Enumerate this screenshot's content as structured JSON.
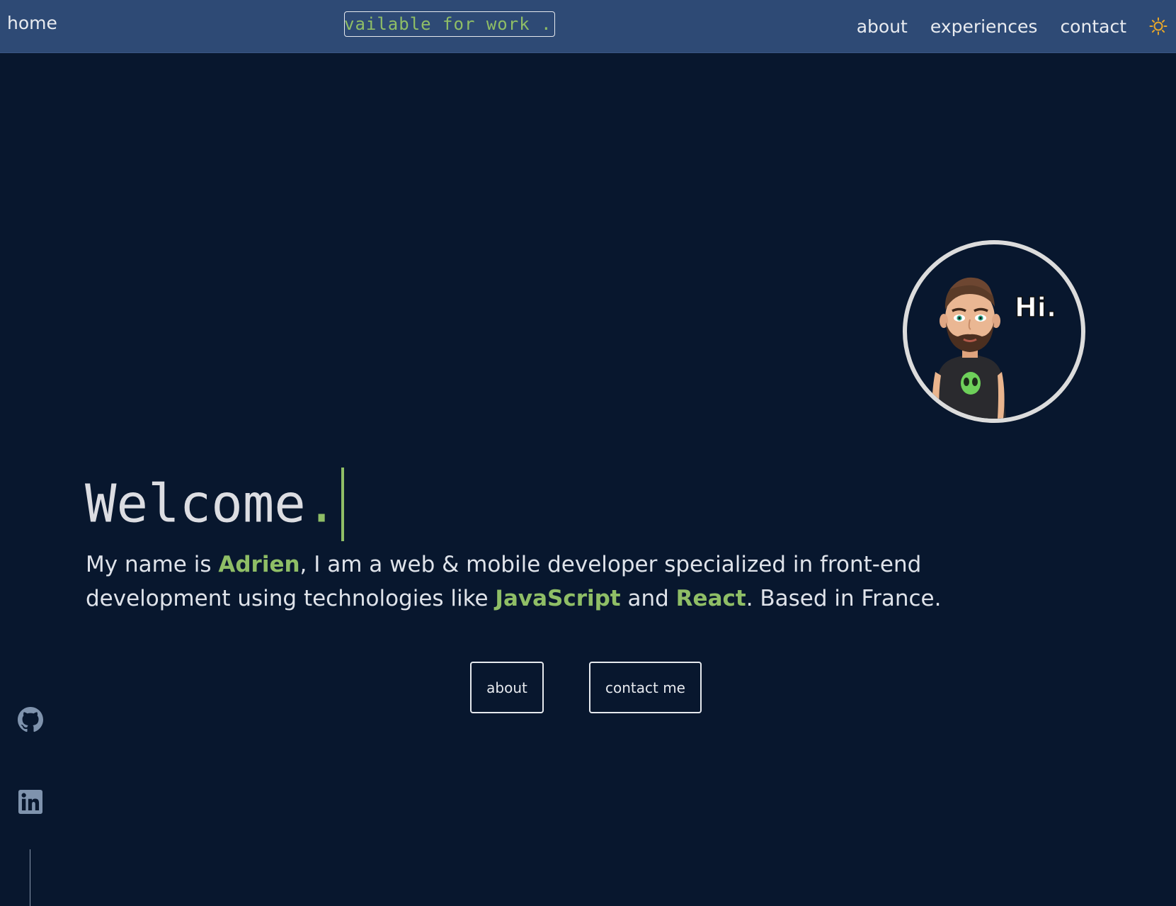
{
  "nav": {
    "home_label": "home",
    "marquee_text": "vailable for work . A",
    "links": [
      {
        "label": "about"
      },
      {
        "label": "experiences"
      },
      {
        "label": "contact"
      }
    ],
    "theme_toggle_icon": "sun-icon"
  },
  "avatar": {
    "greeting": "Hi."
  },
  "hero": {
    "welcome_word": "Welcome",
    "welcome_dot": ".",
    "intro": {
      "prefix": "My name is ",
      "name": "Adrien",
      "middle": ", I am a web & mobile developer specialized in front-end development using technologies like ",
      "tech1": "JavaScript",
      "and": " and ",
      "tech2": "React",
      "suffix": ". Based in France."
    },
    "buttons": {
      "about": "about",
      "contact": "contact me"
    }
  },
  "social": {
    "icons": [
      "github-icon",
      "linkedin-icon"
    ]
  },
  "colors": {
    "background": "#08172e",
    "navbar": "#2e4a75",
    "accent": "#8fbe66",
    "text": "#dfe3ea",
    "sun": "#e8a72a",
    "social_icon": "#7f93ad"
  }
}
